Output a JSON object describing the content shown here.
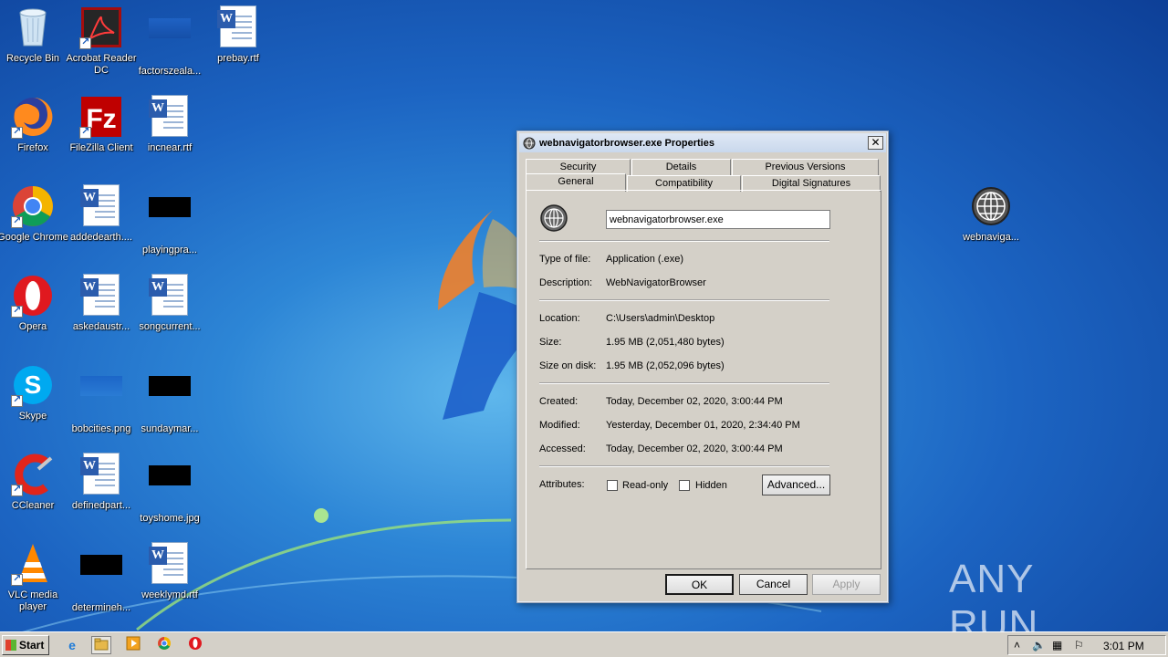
{
  "desktop": {
    "icons": [
      {
        "label": "Recycle Bin",
        "icon": "recycle-bin-icon"
      },
      {
        "label": "Acrobat Reader DC",
        "icon": "acrobat-icon"
      },
      {
        "label": "factorszeala...",
        "icon": "image-file-icon"
      },
      {
        "label": "prebay.rtf",
        "icon": "word-document-icon"
      },
      {
        "label": "Firefox",
        "icon": "firefox-icon"
      },
      {
        "label": "FileZilla Client",
        "icon": "filezilla-icon"
      },
      {
        "label": "incnear.rtf",
        "icon": "word-document-icon"
      },
      {
        "label": "Google Chrome",
        "icon": "chrome-icon"
      },
      {
        "label": "addedearth....",
        "icon": "word-document-icon"
      },
      {
        "label": "playingpra...",
        "icon": "image-file-icon"
      },
      {
        "label": "Opera",
        "icon": "opera-icon"
      },
      {
        "label": "askedaustr...",
        "icon": "word-document-icon"
      },
      {
        "label": "songcurrent...",
        "icon": "word-document-icon"
      },
      {
        "label": "Skype",
        "icon": "skype-icon"
      },
      {
        "label": "bobcities.png",
        "icon": "image-file-icon"
      },
      {
        "label": "sundaymar...",
        "icon": "image-file-icon"
      },
      {
        "label": "CCleaner",
        "icon": "ccleaner-icon"
      },
      {
        "label": "definedpart...",
        "icon": "word-document-icon"
      },
      {
        "label": "toyshome.jpg",
        "icon": "image-file-icon"
      },
      {
        "label": "VLC media player",
        "icon": "vlc-icon"
      },
      {
        "label": "determineh...",
        "icon": "image-file-icon"
      },
      {
        "label": "weeklymd.rtf",
        "icon": "word-document-icon"
      },
      {
        "label": "webnaviga...",
        "icon": "globe-icon"
      }
    ]
  },
  "dialog": {
    "title": "webnavigatorbrowser.exe Properties",
    "tabs_back": [
      "Security",
      "Details",
      "Previous Versions"
    ],
    "tabs_front": [
      "General",
      "Compatibility",
      "Digital Signatures"
    ],
    "active_tab": "General",
    "filename": "webnavigatorbrowser.exe",
    "type_label": "Type of file:",
    "type_value": "Application (.exe)",
    "desc_label": "Description:",
    "desc_value": "WebNavigatorBrowser",
    "location_label": "Location:",
    "location_value": "C:\\Users\\admin\\Desktop",
    "size_label": "Size:",
    "size_value": "1.95 MB (2,051,480 bytes)",
    "disk_label": "Size on disk:",
    "disk_value": "1.95 MB (2,052,096 bytes)",
    "created_label": "Created:",
    "created_value": "Today, December 02, 2020, 3:00:44 PM",
    "modified_label": "Modified:",
    "modified_value": "Yesterday, December 01, 2020, 2:34:40 PM",
    "accessed_label": "Accessed:",
    "accessed_value": "Today, December 02, 2020, 3:00:44 PM",
    "attributes_label": "Attributes:",
    "readonly_label": "Read-only",
    "hidden_label": "Hidden",
    "advanced_label": "Advanced...",
    "ok_label": "OK",
    "cancel_label": "Cancel",
    "apply_label": "Apply"
  },
  "taskbar": {
    "start_label": "Start",
    "clock": "3:01 PM"
  },
  "watermark": "ANY RUN"
}
